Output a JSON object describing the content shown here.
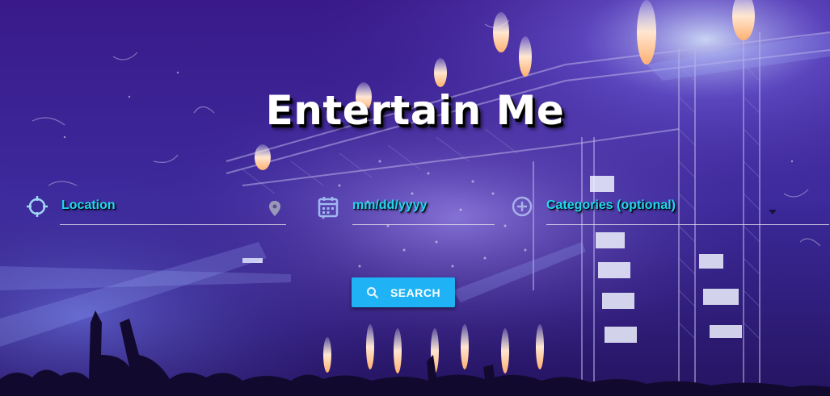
{
  "hero": {
    "title": "Entertain Me"
  },
  "form": {
    "location_placeholder": "Location",
    "date_placeholder": "mm/dd/yyyy",
    "categories_placeholder": "Categories (optional)",
    "search_label": "SEARCH"
  },
  "icons": {
    "location": "crosshair-icon",
    "map_pin": "map-pin-icon",
    "date": "calendar-icon",
    "categories": "plus-circle-icon",
    "dropdown": "caret-down-icon",
    "search": "search-icon"
  },
  "colors": {
    "accent": "#22d8f0",
    "button": "#1fb3f5",
    "title": "#ffffff"
  }
}
